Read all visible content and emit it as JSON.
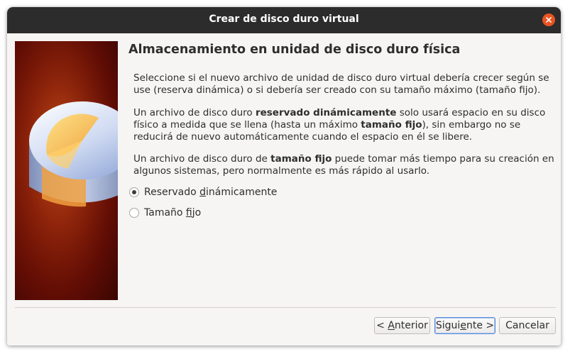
{
  "window": {
    "title": "Crear de disco duro virtual"
  },
  "page": {
    "heading": "Almacenamiento en unidad de disco duro física",
    "paragraph1": "Seleccione si el nuevo archivo de unidad de disco duro virtual debería crecer según se use (reserva dinámica) o si debería ser creado con su tamaño máximo (tamaño fijo).",
    "paragraph2": {
      "t1": "Un archivo de disco duro ",
      "b1": "reservado dinámicamente",
      "t2": " solo usará espacio en su disco físico a medida que se llena (hasta un máximo ",
      "b2": "tamaño fijo",
      "t3": "), sin embargo no se reducirá de nuevo automáticamente cuando el espacio en él se libere."
    },
    "paragraph3": {
      "t1": "Un archivo de disco duro de ",
      "b1": "tamaño fijo",
      "t2": " puede tomar más tiempo para su creación en algunos sistemas, pero normalmente es más rápido al usarlo."
    }
  },
  "options": [
    {
      "label_pre": "Reservado ",
      "label_mn": "d",
      "label_post": "inámicamente",
      "selected": true
    },
    {
      "label_pre": "Tamaño ",
      "label_mn": "f",
      "label_post": "ijo",
      "selected": false
    }
  ],
  "buttons": {
    "back": {
      "pre": "< ",
      "mn": "A",
      "post": "nterior"
    },
    "next": {
      "pre": "Sigui",
      "mn": "e",
      "post": "nte >"
    },
    "cancel": "Cancelar"
  },
  "colors": {
    "titlebar": "#2c2c2c",
    "close_button": "#e95420",
    "dialog_background": "#f6f5f4",
    "banner_red": "#8a1e08"
  },
  "icons": {
    "close": "close-icon",
    "banner": "hard-disk-illustration"
  }
}
